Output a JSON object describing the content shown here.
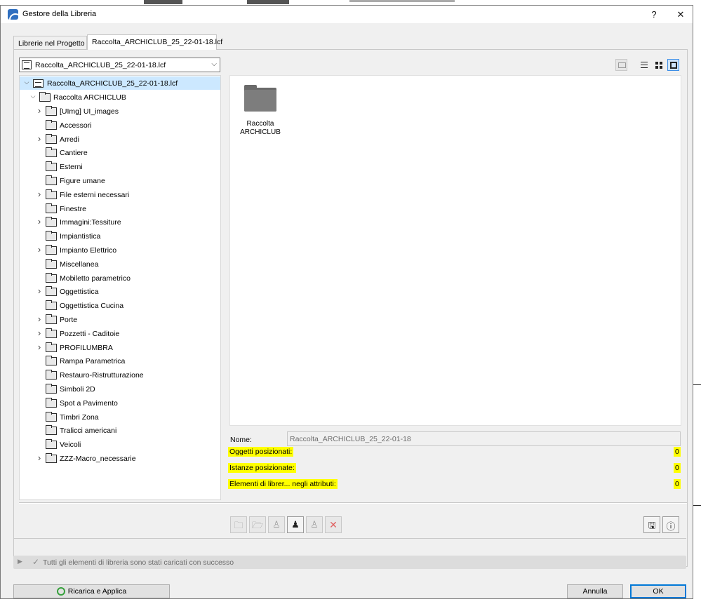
{
  "window": {
    "title": "Gestore della Libreria",
    "help_label": "?",
    "close_label": "✕"
  },
  "tabs": [
    "Librerie nel Progetto",
    "Raccolta_ARCHICLUB_25_22-01-18.lcf"
  ],
  "library_select": {
    "value": "Raccolta_ARCHICLUB_25_22-01-18.lcf",
    "arrow": "⌵"
  },
  "view_modes": [
    "folder-up-icon",
    "list-view-icon",
    "grid-view-icon",
    "large-icon-view-icon"
  ],
  "tree": {
    "root": "Raccolta_ARCHICLUB_25_22-01-18.lcf",
    "folder": "Raccolta ARCHICLUB",
    "items": [
      {
        "label": "[UImg] UI_images",
        "expandable": true
      },
      {
        "label": "Accessori",
        "expandable": false
      },
      {
        "label": "Arredi",
        "expandable": true
      },
      {
        "label": "Cantiere",
        "expandable": false
      },
      {
        "label": "Esterni",
        "expandable": false
      },
      {
        "label": "Figure umane",
        "expandable": false
      },
      {
        "label": "File esterni necessari",
        "expandable": true
      },
      {
        "label": "Finestre",
        "expandable": false
      },
      {
        "label": "Immagini:Tessiture",
        "expandable": true
      },
      {
        "label": "Impiantistica",
        "expandable": false
      },
      {
        "label": "Impianto Elettrico",
        "expandable": true
      },
      {
        "label": "Miscellanea",
        "expandable": false
      },
      {
        "label": "Mobiletto parametrico",
        "expandable": false
      },
      {
        "label": "Oggettistica",
        "expandable": true
      },
      {
        "label": "Oggettistica Cucina",
        "expandable": false
      },
      {
        "label": "Porte",
        "expandable": true
      },
      {
        "label": "Pozzetti - Caditoie",
        "expandable": true
      },
      {
        "label": "PROFILUMBRA",
        "expandable": true
      },
      {
        "label": "Rampa Parametrica",
        "expandable": false
      },
      {
        "label": "Restauro-Ristrutturazione",
        "expandable": false
      },
      {
        "label": "Simboli 2D",
        "expandable": false
      },
      {
        "label": "Spot a Pavimento",
        "expandable": false
      },
      {
        "label": "Timbri Zona",
        "expandable": false
      },
      {
        "label": "Tralicci americani",
        "expandable": false
      },
      {
        "label": "Veicoli",
        "expandable": false
      },
      {
        "label": "ZZZ-Macro_necessarie",
        "expandable": true
      }
    ]
  },
  "content": {
    "folder_label": "Raccolta ARCHICLUB"
  },
  "details": {
    "name_label": "Nome:",
    "name_value": "Raccolta_ARCHICLUB_25_22-01-18",
    "stats": [
      {
        "label": "Oggetti posizionati:",
        "value": "0"
      },
      {
        "label": "Istanze posizionate:",
        "value": "0"
      },
      {
        "label": "Elementi di librer... negli attributi:",
        "value": "0"
      }
    ]
  },
  "toolbar": {
    "icons": [
      "new-folder-icon",
      "import-folder-icon",
      "object-settings-icon",
      "placed-objects-icon",
      "object-edit-icon",
      "delete-icon"
    ]
  },
  "status": {
    "message": "Tutti gli elementi di libreria sono stati caricati con successo"
  },
  "buttons": {
    "reload": "Ricarica e Applica",
    "cancel": "Annulla",
    "ok": "OK"
  },
  "colors": {
    "highlight": "#ffff00",
    "selection": "#cce8ff",
    "accent": "#0078d7"
  }
}
